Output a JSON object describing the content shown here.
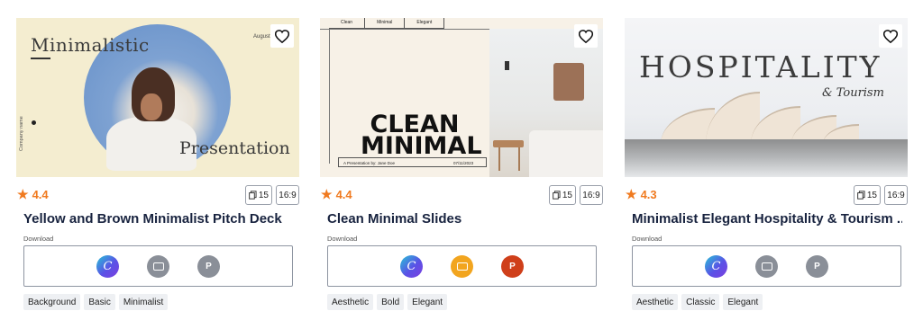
{
  "cards": [
    {
      "thumbnail": {
        "heading": "Minimalistic",
        "subheading": "Presentation",
        "month": "August",
        "company": "Company name"
      },
      "rating": "4.4",
      "pages": "15",
      "ratio": "16:9",
      "title": "Yellow and Brown Minimalist Pitch Deck",
      "download_label": "Download",
      "formats": [
        "canva-icon",
        "google-slides-icon",
        "powerpoint-icon"
      ],
      "tags": [
        "Background",
        "Basic",
        "Minimalist"
      ]
    },
    {
      "thumbnail": {
        "nav": [
          "Clean",
          "Minimal",
          "Elegant"
        ],
        "heading_line1": "CLEAN",
        "heading_line2": "MINIMAL",
        "byline": "A Presentation by: Jane Doe",
        "date": "07/11/2023"
      },
      "rating": "4.4",
      "pages": "15",
      "ratio": "16:9",
      "title": "Clean Minimal Slides",
      "download_label": "Download",
      "formats": [
        "canva-icon",
        "google-slides-icon",
        "powerpoint-icon"
      ],
      "tags": [
        "Aesthetic",
        "Bold",
        "Elegant"
      ]
    },
    {
      "thumbnail": {
        "heading": "HOSPITALITY",
        "subheading": "& Tourism"
      },
      "rating": "4.3",
      "pages": "15",
      "ratio": "16:9",
      "title": "Minimalist Elegant Hospitality & Tourism ...",
      "download_label": "Download",
      "formats": [
        "canva-icon",
        "google-slides-icon",
        "powerpoint-icon"
      ],
      "tags": [
        "Aesthetic",
        "Classic",
        "Elegant"
      ]
    }
  ],
  "colors": {
    "rating": "#f07a1f",
    "title": "#18233f",
    "google_slides_active": "#f2a51f",
    "powerpoint_active": "#cf3f1a",
    "inactive_icon": "#8a8f98"
  }
}
